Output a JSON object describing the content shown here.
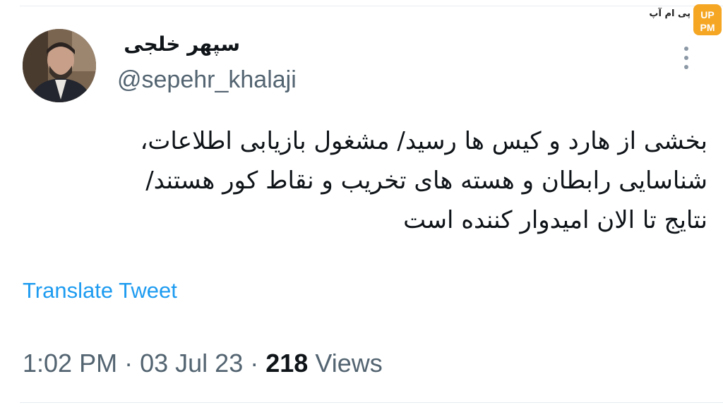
{
  "tweet": {
    "author_name": "سپهر خلجی",
    "author_handle": "@sepehr_khalaji",
    "body_lines": [
      "بخشی از هارد و کیس ها رسید/ مشغول بازیابی اطلاعات،",
      "شناسایی رابطان و هسته های تخریب و نقاط کور هستند/",
      "نتایج تا الان امیدوار کننده است"
    ],
    "translate_label": "Translate Tweet",
    "time": "1:02 PM",
    "separator": "·",
    "date": "03 Jul 23",
    "views_count": "218",
    "views_label": "Views"
  },
  "watermark": {
    "text": "پی ام آپ",
    "badge": "PM UP",
    "color": "#f5a623"
  },
  "icons": {
    "more": "more-vertical-icon",
    "avatar": "profile-photo"
  },
  "colors": {
    "text_primary": "#0f1419",
    "text_secondary": "#536471",
    "link": "#1d9bf0"
  }
}
